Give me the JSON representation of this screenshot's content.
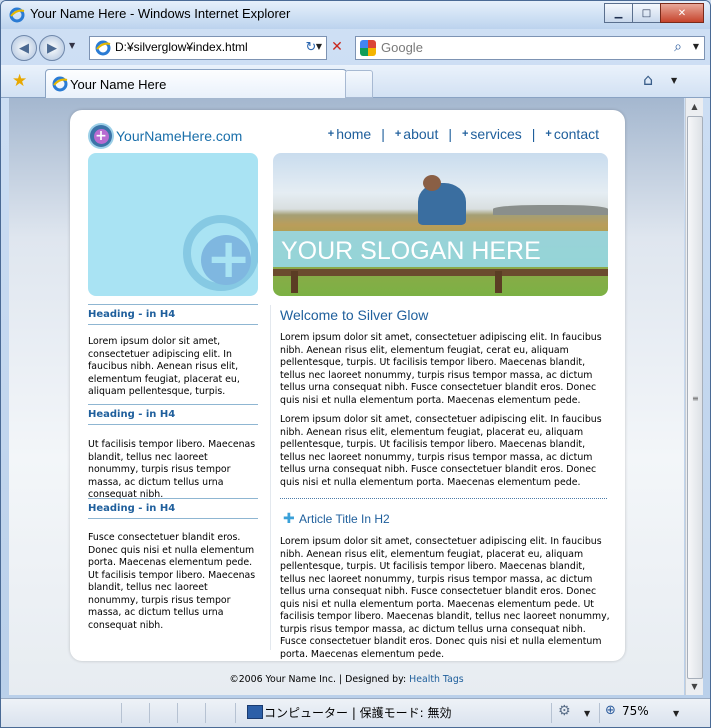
{
  "window": {
    "title": "Your Name Here - Windows Internet Explorer",
    "minimize": "▁",
    "maximize": "□",
    "close": "✕"
  },
  "toolbar": {
    "back": "◀",
    "forward": "▶",
    "address": "D:¥silverglow¥index.html",
    "refresh": "↻",
    "stop": "✕",
    "search_placeholder": "Google",
    "search_icon": "⌕"
  },
  "tabs": {
    "favorites_icon": "★",
    "active_tab": "Your Name Here",
    "home_icon": "⌂"
  },
  "site": {
    "logo_text": "YourNameHere.com",
    "nav": [
      {
        "label": "home"
      },
      {
        "label": "about"
      },
      {
        "label": "services"
      },
      {
        "label": "contact"
      }
    ],
    "slogan": "YOUR SLOGAN HERE",
    "sidebar": [
      {
        "heading": "Heading - in H4",
        "text": "Lorem ipsum dolor sit amet, consectetuer adipiscing elit. In faucibus nibh. Aenean risus elit, elementum feugiat, placerat eu, aliquam pellentesque, turpis."
      },
      {
        "heading": "Heading - in H4",
        "text": "Ut facilisis tempor libero. Maecenas blandit, tellus nec laoreet nonummy, turpis risus tempor massa, ac dictum tellus urna consequat nibh."
      },
      {
        "heading": "Heading - in H4",
        "text": "Fusce consectetuer blandit eros. Donec quis nisi et nulla elementum porta. Maecenas elementum pede. Ut facilisis tempor libero. Maecenas blandit, tellus nec laoreet nonummy, turpis risus tempor massa, ac dictum tellus urna consequat nibh."
      }
    ],
    "main_heading": "Welcome to Silver Glow",
    "paragraphs": [
      "Lorem ipsum dolor sit amet, consectetuer adipiscing elit. In faucibus nibh. Aenean risus elit, elementum feugiat, cerat eu, aliquam pellentesque, turpis. Ut facilisis tempor libero. Maecenas blandit, tellus nec laoreet nonummy, turpis risus tempor massa, ac dictum tellus urna consequat nibh. Fusce consectetuer blandit eros. Donec quis nisi et nulla elementum porta. Maecenas elementum pede.",
      "Lorem ipsum dolor sit amet, consectetuer adipiscing elit. In faucibus nibh. Aenean risus elit, elementum feugiat, placerat eu, aliquam pellentesque, turpis. Ut facilisis tempor libero. Maecenas blandit, tellus nec laoreet nonummy, turpis risus tempor massa, ac dictum tellus urna consequat nibh. Fusce consectetuer blandit eros. Donec quis nisi et nulla elementum porta. Maecenas elementum pede."
    ],
    "article_title": "Article Title In H2",
    "article_text": "Lorem ipsum dolor sit amet, consectetuer adipiscing elit. In faucibus nibh. Aenean risus elit, elementum feugiat, placerat eu, aliquam pellentesque, turpis. Ut facilisis tempor libero. Maecenas blandit, tellus nec laoreet nonummy, turpis risus tempor massa, ac dictum tellus urna consequat nibh. Fusce consectetuer blandit eros. Donec quis nisi et nulla elementum porta. Maecenas elementum pede. Ut facilisis tempor libero. Maecenas blandit, tellus nec laoreet nonummy, turpis risus tempor massa, ac dictum tellus urna consequat nibh. Fusce consectetuer blandit eros. Donec quis nisi et nulla elementum porta. Maecenas elementum pede.",
    "footer_text": "©2006 Your Name Inc. | Designed by:",
    "footer_link": "Health Tags"
  },
  "status": {
    "zone": "コンピューター | 保護モード: 無効",
    "zoom": "75%"
  },
  "colors": {
    "accent": "#1f5f9c",
    "sidebar_box": "#a9e3f3"
  }
}
